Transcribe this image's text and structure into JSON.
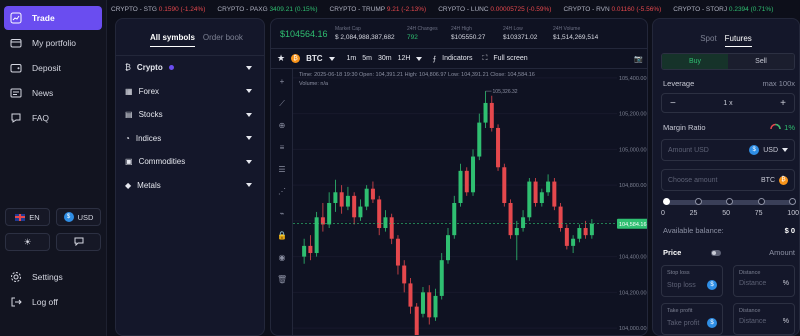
{
  "nav": {
    "items": [
      {
        "label": "Trade",
        "icon": "chart-line-icon",
        "active": true
      },
      {
        "label": "My portfolio",
        "icon": "wallet-icon"
      },
      {
        "label": "Deposit",
        "icon": "deposit-icon"
      },
      {
        "label": "News",
        "icon": "news-icon"
      },
      {
        "label": "FAQ",
        "icon": "faq-icon"
      }
    ],
    "language": "EN",
    "currency": "USD",
    "settings": "Settings",
    "logout": "Log off"
  },
  "ticker": [
    {
      "text": "CRYPTO - STG",
      "price": "0.1590",
      "change": "(-1.24%)",
      "dir": "neg"
    },
    {
      "text": "CRYPTO - PAXG",
      "price": "3409.21",
      "change": "(0.15%)",
      "dir": "pos"
    },
    {
      "text": "CRYPTO - TRUMP",
      "price": "9.21",
      "change": "(-2.13%)",
      "dir": "neg"
    },
    {
      "text": "CRYPTO - LUNC",
      "price": "0.00005725",
      "change": "(-0.59%)",
      "dir": "neg"
    },
    {
      "text": "CRYPTO - RVN",
      "price": "0.01160",
      "change": "(-5.56%)",
      "dir": "neg"
    },
    {
      "text": "CRYPTO - STORJ",
      "price": "0.2394",
      "change": "(0.71%)",
      "dir": "pos"
    }
  ],
  "symbols": {
    "tabs": [
      "All symbols",
      "Order book"
    ],
    "categories": [
      "Crypto",
      "Forex",
      "Stocks",
      "Indices",
      "Commodities",
      "Metals"
    ]
  },
  "chart": {
    "price": "$104564.16",
    "stats": [
      {
        "label": "Market Cap",
        "value": "$ 2,084,988,387,682"
      },
      {
        "label": "24H Changes",
        "value": "792"
      },
      {
        "label": "24H High",
        "value": "$105550.27"
      },
      {
        "label": "24H Low",
        "value": "$103371.02"
      },
      {
        "label": "24H Volume",
        "value": "$1,514,269,514"
      }
    ],
    "symbol": "BTC",
    "intervals": [
      "1m",
      "5m",
      "30m",
      "12H"
    ],
    "indicators": "Indicators",
    "fullscreen": "Full screen",
    "ohlc_line": "Time: 2025-06-18 19:30     Open: 104,391.21     High: 104,806.97     Low: 104,391.21     Close: 104,584.16",
    "volume_line": "Volume: n/a",
    "max_label": "105,326.32",
    "current_label": "104,584.16"
  },
  "chart_data": {
    "type": "candlestick",
    "y_ticks": [
      105400,
      105200,
      105000,
      104800,
      104600,
      104400,
      104200,
      104000
    ],
    "ylim": [
      103950,
      105450
    ],
    "current": 104584.16,
    "high_marker": 105326.32,
    "candles": [
      [
        104400,
        104460,
        104360,
        104500
      ],
      [
        104460,
        104420,
        104380,
        104520
      ],
      [
        104420,
        104620,
        104400,
        104650
      ],
      [
        104620,
        104580,
        104540,
        104700
      ],
      [
        104580,
        104700,
        104560,
        104760
      ],
      [
        104700,
        104760,
        104650,
        104830
      ],
      [
        104760,
        104680,
        104640,
        104800
      ],
      [
        104680,
        104740,
        104660,
        104790
      ],
      [
        104740,
        104620,
        104580,
        104760
      ],
      [
        104620,
        104680,
        104600,
        104720
      ],
      [
        104680,
        104780,
        104660,
        104800
      ],
      [
        104780,
        104720,
        104700,
        104820
      ],
      [
        104720,
        104560,
        104520,
        104740
      ],
      [
        104560,
        104620,
        104540,
        104660
      ],
      [
        104620,
        104500,
        104470,
        104640
      ],
      [
        104500,
        104350,
        104300,
        104520
      ],
      [
        104350,
        104250,
        104200,
        104380
      ],
      [
        104250,
        104120,
        104080,
        104280
      ],
      [
        104120,
        103960,
        103900,
        104140
      ],
      [
        104080,
        104200,
        104060,
        104230
      ],
      [
        104200,
        104060,
        104020,
        104240
      ],
      [
        104060,
        104180,
        104040,
        104220
      ],
      [
        104180,
        104380,
        104160,
        104420
      ],
      [
        104380,
        104520,
        104360,
        104560
      ],
      [
        104520,
        104700,
        104500,
        104740
      ],
      [
        104700,
        104880,
        104680,
        104920
      ],
      [
        104880,
        104760,
        104740,
        104900
      ],
      [
        104760,
        104960,
        104740,
        105000
      ],
      [
        104960,
        105150,
        104940,
        105200
      ],
      [
        105150,
        105260,
        105120,
        105326
      ],
      [
        105260,
        105120,
        105100,
        105300
      ],
      [
        105120,
        104900,
        104880,
        105140
      ],
      [
        104900,
        104700,
        104680,
        104920
      ],
      [
        104700,
        104520,
        104500,
        104720
      ],
      [
        104520,
        104560,
        104380,
        104600
      ],
      [
        104560,
        104620,
        104540,
        104660
      ],
      [
        104620,
        104820,
        104600,
        104840
      ],
      [
        104820,
        104700,
        104680,
        104840
      ],
      [
        104700,
        104760,
        104680,
        104780
      ],
      [
        104760,
        104820,
        104740,
        104860
      ],
      [
        104820,
        104680,
        104660,
        104840
      ],
      [
        104680,
        104560,
        104540,
        104700
      ],
      [
        104560,
        104460,
        104440,
        104580
      ],
      [
        104460,
        104500,
        104420,
        104520
      ],
      [
        104500,
        104560,
        104480,
        104580
      ],
      [
        104560,
        104520,
        104500,
        104600
      ],
      [
        104520,
        104584,
        104500,
        104610
      ]
    ]
  },
  "trade": {
    "tabs": [
      "Spot",
      "Futures"
    ],
    "buy": "Buy",
    "sell": "Sell",
    "leverage_label": "Leverage",
    "leverage_max": "max 100x",
    "leverage_value": "1 x",
    "margin_label": "Margin Ratio",
    "margin_value": "1%",
    "amount_placeholder": "Amount USD",
    "amount_currency": "USD",
    "choose_placeholder": "Choose amount",
    "choose_currency": "BTC",
    "slider_ticks": [
      "0",
      "25",
      "50",
      "75",
      "100"
    ],
    "slider_value": 0,
    "available_label": "Available balance:",
    "available_value": "$ 0",
    "price_label": "Price",
    "amount_label": "Amount",
    "stop_loss": "Stop loss",
    "take_profit": "Take profit",
    "distance": "Distance",
    "percent": "%"
  }
}
